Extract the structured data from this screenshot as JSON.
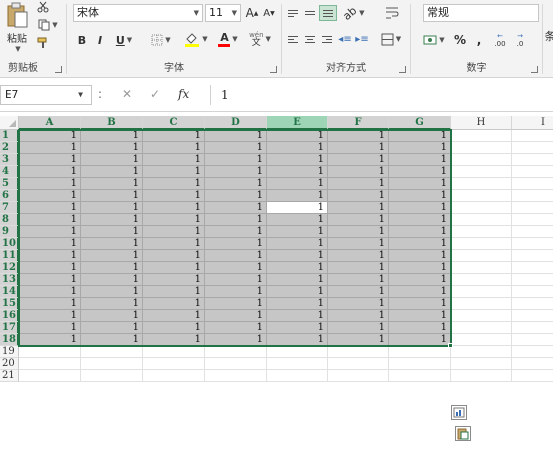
{
  "ribbon": {
    "clipboard": {
      "paste_label": "粘贴",
      "group_label": "剪贴板"
    },
    "font": {
      "font_name": "宋体",
      "font_size": "11",
      "bold": "B",
      "italic": "I",
      "underline": "U",
      "grow_font": "A",
      "shrink_font": "A",
      "font_color_glyph": "A",
      "phonetic_glyph": "wén",
      "phonetic_char": "文",
      "group_label": "字体"
    },
    "alignment": {
      "group_label": "对齐方式"
    },
    "number": {
      "format": "常规",
      "percent": "%",
      "comma": ",",
      "increase_decimal": ".00",
      "decrease_decimal": ".0",
      "group_label": "数字"
    },
    "cut_off_label": "条"
  },
  "formula_bar": {
    "name_box": "E7",
    "separator_glyph": ":",
    "cancel_glyph": "✕",
    "enter_glyph": "✓",
    "fx_label": "fx",
    "formula": "1"
  },
  "grid": {
    "columns": [
      "A",
      "B",
      "C",
      "D",
      "E",
      "F",
      "G",
      "H",
      "I"
    ],
    "rows": [
      "1",
      "2",
      "3",
      "4",
      "5",
      "6",
      "7",
      "8",
      "9",
      "10",
      "11",
      "12",
      "13",
      "14",
      "15",
      "16",
      "17",
      "18",
      "19",
      "20",
      "21"
    ],
    "selection": {
      "start": "A1",
      "end": "G18",
      "active_cell": "E7"
    },
    "cell_value": "1",
    "colors": {
      "selection_border": "#217346",
      "selection_fill": "#c6c6c6",
      "active_header": "#9fd5b7"
    }
  },
  "icons": [
    "paste-icon",
    "cut-icon",
    "copy-icon",
    "format-painter-icon",
    "border-icon",
    "fill-color-icon",
    "font-color-icon",
    "wrap-text-icon",
    "merge-center-icon",
    "accounting-icon",
    "quick-analysis-icon",
    "paste-options-icon"
  ]
}
